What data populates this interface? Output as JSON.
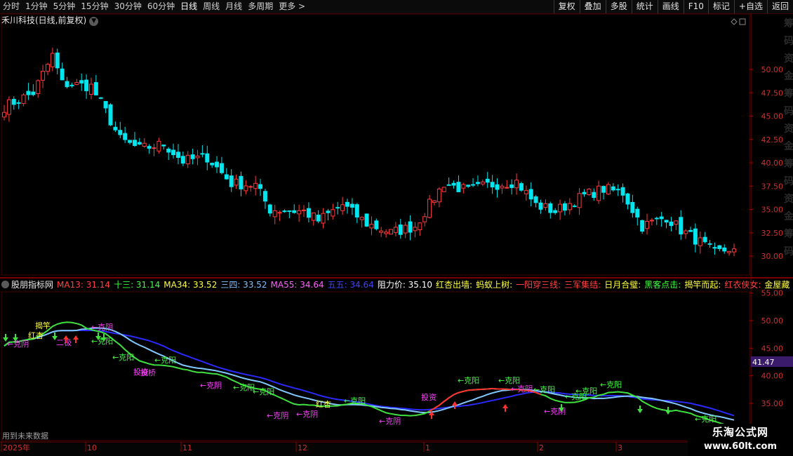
{
  "toolbar": {
    "periods": [
      "分时",
      "1分钟",
      "5分钟",
      "15分钟",
      "30分钟",
      "60分钟",
      "日线",
      "周线",
      "月线",
      "多周期",
      "更多 >"
    ],
    "active_period": "日线",
    "right_tools": [
      "复权",
      "叠加",
      "多股",
      "统计",
      "画线",
      "F10",
      "标记",
      "+自选",
      "返回"
    ]
  },
  "main": {
    "title": "禾川科技(日线,前复权)",
    "y_ticks": [
      "50.00",
      "47.50",
      "45.00",
      "42.50",
      "40.00",
      "37.50",
      "35.00",
      "32.50",
      "30.00"
    ],
    "side_strip": "筹码资金",
    "up_color": "#ff3a3a",
    "down_color": "#00e5ee"
  },
  "indicator": {
    "name": "股朋指标网",
    "items": [
      {
        "text": "MA13: 31.14",
        "color": "#ff4040"
      },
      {
        "text": "十三: 31.14",
        "color": "#40ff40"
      },
      {
        "text": "MA34: 33.52",
        "color": "#ffff40"
      },
      {
        "text": "三四: 33.52",
        "color": "#80c0ff"
      },
      {
        "text": "MA55: 34.64",
        "color": "#ff60ff"
      },
      {
        "text": "五五: 34.64",
        "color": "#4040ff"
      },
      {
        "text": "阻力价: 35.10",
        "color": "#ffffff"
      },
      {
        "text": "红杏出墙:",
        "color": "#ffff40"
      },
      {
        "text": "蚂蚁上树:",
        "color": "#ffff40"
      },
      {
        "text": "一阳穿三线:",
        "color": "#ff4040"
      },
      {
        "text": "三军集结:",
        "color": "#ff4040"
      },
      {
        "text": "日月合璧:",
        "color": "#ffff40"
      },
      {
        "text": "黑客点击:",
        "color": "#40ff40"
      },
      {
        "text": "揭竿而起:",
        "color": "#ffff40"
      },
      {
        "text": "红衣侠女:",
        "color": "#ff4040"
      },
      {
        "text": "金屋藏",
        "color": "#ffff40"
      }
    ],
    "y_ticks": [
      "55.00",
      "50.00",
      "45.00",
      "40.00",
      "35.00"
    ],
    "current_label": "41.47",
    "footer_note": "用到未来数据",
    "annotations": [
      {
        "text": "←克阳",
        "color": "#40ff40"
      },
      {
        "text": "←克阴",
        "color": "#ff40ff"
      },
      {
        "text": "投资",
        "color": "#ff40ff"
      },
      {
        "text": "揭竿",
        "color": "#ffff40"
      },
      {
        "text": "红杏",
        "color": "#ffff40"
      },
      {
        "text": "二极",
        "color": "#ff40ff"
      },
      {
        "text": "投桥",
        "color": "#ff40ff"
      }
    ]
  },
  "x_axis": {
    "labels": [
      "2025年",
      "10",
      "11",
      "12",
      "1",
      "2",
      "3"
    ]
  },
  "watermark": {
    "line1": "乐淘公式网",
    "line2": "www.60lt.com"
  }
}
